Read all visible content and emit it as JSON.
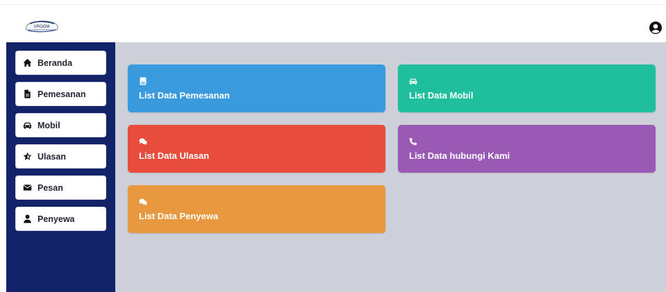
{
  "header": {
    "logo_text": "VROOM",
    "user_icon": "user-circle-icon"
  },
  "sidebar": {
    "items": [
      {
        "label": "Beranda",
        "icon": "home-icon"
      },
      {
        "label": "Pemesanan",
        "icon": "file-icon"
      },
      {
        "label": "Mobil",
        "icon": "car-icon"
      },
      {
        "label": "Ulasan",
        "icon": "star-icon"
      },
      {
        "label": "Pesan",
        "icon": "envelope-icon"
      },
      {
        "label": "Penyewa",
        "icon": "user-icon"
      }
    ]
  },
  "cards": [
    {
      "label": "List Data Pemesanan",
      "icon": "book-icon",
      "color": "#3a9ade"
    },
    {
      "label": "List Data Mobil",
      "icon": "car-icon",
      "color": "#1fbf9e"
    },
    {
      "label": "List Data Ulasan",
      "icon": "comments-icon",
      "color": "#e74c3c"
    },
    {
      "label": "List Data hubungi Kami",
      "icon": "phone-icon",
      "color": "#9b59b6"
    },
    {
      "label": "List Data Penyewa",
      "icon": "comments-icon",
      "color": "#e8993f"
    }
  ],
  "colors": {
    "sidebar_bg": "#13236a",
    "main_bg": "#cdcfd9"
  }
}
